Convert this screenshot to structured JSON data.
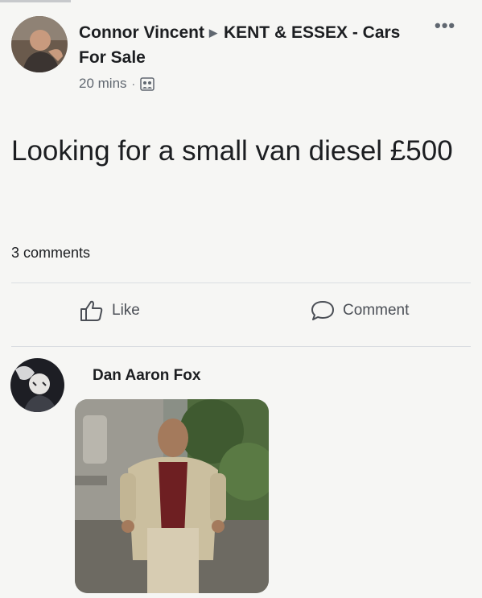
{
  "post": {
    "author": "Connor Vincent",
    "group": "KENT & ESSEX - Cars For Sale",
    "timestamp": "20 mins",
    "text": "Looking for a small van diesel £500",
    "comments_count": "3 comments"
  },
  "actions": {
    "like_label": "Like",
    "comment_label": "Comment"
  },
  "comment": {
    "author": "Dan Aaron Fox"
  },
  "icons": {
    "more": "more-options-icon",
    "group": "group-icon",
    "like": "thumbs-up-icon",
    "comment": "speech-bubble-icon"
  },
  "colors": {
    "background": "#f6f6f4",
    "text": "#1c1e21",
    "secondary": "#606770",
    "divider": "#dadde1"
  }
}
